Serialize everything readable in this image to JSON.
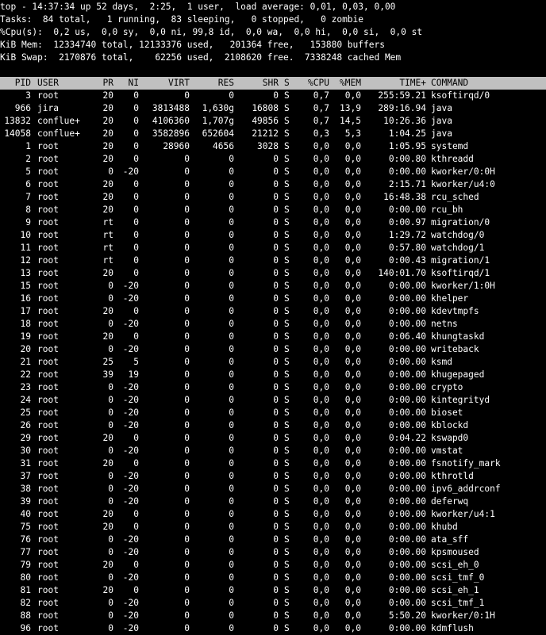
{
  "summary": {
    "line1": "top - 14:37:34 up 52 days,  2:25,  1 user,  load average: 0,01, 0,03, 0,00",
    "line2": "Tasks:  84 total,   1 running,  83 sleeping,   0 stopped,   0 zombie",
    "line3": "%Cpu(s):  0,2 us,  0,0 sy,  0,0 ni, 99,8 id,  0,0 wa,  0,0 hi,  0,0 si,  0,0 st",
    "line4": "KiB Mem:  12334740 total, 12133376 used,   201364 free,   153880 buffers",
    "line5": "KiB Swap:  2170876 total,    62256 used,  2108620 free.  7338248 cached Mem"
  },
  "columns": {
    "pid": "PID",
    "user": "USER",
    "pr": "PR",
    "ni": "NI",
    "virt": "VIRT",
    "res": "RES",
    "shr": "SHR",
    "s": "S",
    "cpu": "%CPU",
    "mem": "%MEM",
    "time": "TIME+",
    "command": "COMMAND"
  },
  "processes": [
    {
      "pid": "3",
      "user": "root",
      "pr": "20",
      "ni": "0",
      "virt": "0",
      "res": "0",
      "shr": "0",
      "s": "S",
      "cpu": "0,7",
      "mem": "0,0",
      "time": "255:59.21",
      "command": "ksoftirqd/0"
    },
    {
      "pid": "966",
      "user": "jira",
      "pr": "20",
      "ni": "0",
      "virt": "3813488",
      "res": "1,630g",
      "shr": "16808",
      "s": "S",
      "cpu": "0,7",
      "mem": "13,9",
      "time": "289:16.94",
      "command": "java"
    },
    {
      "pid": "13832",
      "user": "conflue+",
      "pr": "20",
      "ni": "0",
      "virt": "4106360",
      "res": "1,707g",
      "shr": "49856",
      "s": "S",
      "cpu": "0,7",
      "mem": "14,5",
      "time": "10:26.36",
      "command": "java"
    },
    {
      "pid": "14058",
      "user": "conflue+",
      "pr": "20",
      "ni": "0",
      "virt": "3582896",
      "res": "652604",
      "shr": "21212",
      "s": "S",
      "cpu": "0,3",
      "mem": "5,3",
      "time": "1:04.25",
      "command": "java"
    },
    {
      "pid": "1",
      "user": "root",
      "pr": "20",
      "ni": "0",
      "virt": "28960",
      "res": "4656",
      "shr": "3028",
      "s": "S",
      "cpu": "0,0",
      "mem": "0,0",
      "time": "1:05.95",
      "command": "systemd"
    },
    {
      "pid": "2",
      "user": "root",
      "pr": "20",
      "ni": "0",
      "virt": "0",
      "res": "0",
      "shr": "0",
      "s": "S",
      "cpu": "0,0",
      "mem": "0,0",
      "time": "0:00.80",
      "command": "kthreadd"
    },
    {
      "pid": "5",
      "user": "root",
      "pr": "0",
      "ni": "-20",
      "virt": "0",
      "res": "0",
      "shr": "0",
      "s": "S",
      "cpu": "0,0",
      "mem": "0,0",
      "time": "0:00.00",
      "command": "kworker/0:0H"
    },
    {
      "pid": "6",
      "user": "root",
      "pr": "20",
      "ni": "0",
      "virt": "0",
      "res": "0",
      "shr": "0",
      "s": "S",
      "cpu": "0,0",
      "mem": "0,0",
      "time": "2:15.71",
      "command": "kworker/u4:0"
    },
    {
      "pid": "7",
      "user": "root",
      "pr": "20",
      "ni": "0",
      "virt": "0",
      "res": "0",
      "shr": "0",
      "s": "S",
      "cpu": "0,0",
      "mem": "0,0",
      "time": "16:48.38",
      "command": "rcu_sched"
    },
    {
      "pid": "8",
      "user": "root",
      "pr": "20",
      "ni": "0",
      "virt": "0",
      "res": "0",
      "shr": "0",
      "s": "S",
      "cpu": "0,0",
      "mem": "0,0",
      "time": "0:00.00",
      "command": "rcu_bh"
    },
    {
      "pid": "9",
      "user": "root",
      "pr": "rt",
      "ni": "0",
      "virt": "0",
      "res": "0",
      "shr": "0",
      "s": "S",
      "cpu": "0,0",
      "mem": "0,0",
      "time": "0:00.97",
      "command": "migration/0"
    },
    {
      "pid": "10",
      "user": "root",
      "pr": "rt",
      "ni": "0",
      "virt": "0",
      "res": "0",
      "shr": "0",
      "s": "S",
      "cpu": "0,0",
      "mem": "0,0",
      "time": "1:29.72",
      "command": "watchdog/0"
    },
    {
      "pid": "11",
      "user": "root",
      "pr": "rt",
      "ni": "0",
      "virt": "0",
      "res": "0",
      "shr": "0",
      "s": "S",
      "cpu": "0,0",
      "mem": "0,0",
      "time": "0:57.80",
      "command": "watchdog/1"
    },
    {
      "pid": "12",
      "user": "root",
      "pr": "rt",
      "ni": "0",
      "virt": "0",
      "res": "0",
      "shr": "0",
      "s": "S",
      "cpu": "0,0",
      "mem": "0,0",
      "time": "0:00.43",
      "command": "migration/1"
    },
    {
      "pid": "13",
      "user": "root",
      "pr": "20",
      "ni": "0",
      "virt": "0",
      "res": "0",
      "shr": "0",
      "s": "S",
      "cpu": "0,0",
      "mem": "0,0",
      "time": "140:01.70",
      "command": "ksoftirqd/1"
    },
    {
      "pid": "15",
      "user": "root",
      "pr": "0",
      "ni": "-20",
      "virt": "0",
      "res": "0",
      "shr": "0",
      "s": "S",
      "cpu": "0,0",
      "mem": "0,0",
      "time": "0:00.00",
      "command": "kworker/1:0H"
    },
    {
      "pid": "16",
      "user": "root",
      "pr": "0",
      "ni": "-20",
      "virt": "0",
      "res": "0",
      "shr": "0",
      "s": "S",
      "cpu": "0,0",
      "mem": "0,0",
      "time": "0:00.00",
      "command": "khelper"
    },
    {
      "pid": "17",
      "user": "root",
      "pr": "20",
      "ni": "0",
      "virt": "0",
      "res": "0",
      "shr": "0",
      "s": "S",
      "cpu": "0,0",
      "mem": "0,0",
      "time": "0:00.00",
      "command": "kdevtmpfs"
    },
    {
      "pid": "18",
      "user": "root",
      "pr": "0",
      "ni": "-20",
      "virt": "0",
      "res": "0",
      "shr": "0",
      "s": "S",
      "cpu": "0,0",
      "mem": "0,0",
      "time": "0:00.00",
      "command": "netns"
    },
    {
      "pid": "19",
      "user": "root",
      "pr": "20",
      "ni": "0",
      "virt": "0",
      "res": "0",
      "shr": "0",
      "s": "S",
      "cpu": "0,0",
      "mem": "0,0",
      "time": "0:06.40",
      "command": "khungtaskd"
    },
    {
      "pid": "20",
      "user": "root",
      "pr": "0",
      "ni": "-20",
      "virt": "0",
      "res": "0",
      "shr": "0",
      "s": "S",
      "cpu": "0,0",
      "mem": "0,0",
      "time": "0:00.00",
      "command": "writeback"
    },
    {
      "pid": "21",
      "user": "root",
      "pr": "25",
      "ni": "5",
      "virt": "0",
      "res": "0",
      "shr": "0",
      "s": "S",
      "cpu": "0,0",
      "mem": "0,0",
      "time": "0:00.00",
      "command": "ksmd"
    },
    {
      "pid": "22",
      "user": "root",
      "pr": "39",
      "ni": "19",
      "virt": "0",
      "res": "0",
      "shr": "0",
      "s": "S",
      "cpu": "0,0",
      "mem": "0,0",
      "time": "0:00.00",
      "command": "khugepaged"
    },
    {
      "pid": "23",
      "user": "root",
      "pr": "0",
      "ni": "-20",
      "virt": "0",
      "res": "0",
      "shr": "0",
      "s": "S",
      "cpu": "0,0",
      "mem": "0,0",
      "time": "0:00.00",
      "command": "crypto"
    },
    {
      "pid": "24",
      "user": "root",
      "pr": "0",
      "ni": "-20",
      "virt": "0",
      "res": "0",
      "shr": "0",
      "s": "S",
      "cpu": "0,0",
      "mem": "0,0",
      "time": "0:00.00",
      "command": "kintegrityd"
    },
    {
      "pid": "25",
      "user": "root",
      "pr": "0",
      "ni": "-20",
      "virt": "0",
      "res": "0",
      "shr": "0",
      "s": "S",
      "cpu": "0,0",
      "mem": "0,0",
      "time": "0:00.00",
      "command": "bioset"
    },
    {
      "pid": "26",
      "user": "root",
      "pr": "0",
      "ni": "-20",
      "virt": "0",
      "res": "0",
      "shr": "0",
      "s": "S",
      "cpu": "0,0",
      "mem": "0,0",
      "time": "0:00.00",
      "command": "kblockd"
    },
    {
      "pid": "29",
      "user": "root",
      "pr": "20",
      "ni": "0",
      "virt": "0",
      "res": "0",
      "shr": "0",
      "s": "S",
      "cpu": "0,0",
      "mem": "0,0",
      "time": "0:04.22",
      "command": "kswapd0"
    },
    {
      "pid": "30",
      "user": "root",
      "pr": "0",
      "ni": "-20",
      "virt": "0",
      "res": "0",
      "shr": "0",
      "s": "S",
      "cpu": "0,0",
      "mem": "0,0",
      "time": "0:00.00",
      "command": "vmstat"
    },
    {
      "pid": "31",
      "user": "root",
      "pr": "20",
      "ni": "0",
      "virt": "0",
      "res": "0",
      "shr": "0",
      "s": "S",
      "cpu": "0,0",
      "mem": "0,0",
      "time": "0:00.00",
      "command": "fsnotify_mark"
    },
    {
      "pid": "37",
      "user": "root",
      "pr": "0",
      "ni": "-20",
      "virt": "0",
      "res": "0",
      "shr": "0",
      "s": "S",
      "cpu": "0,0",
      "mem": "0,0",
      "time": "0:00.00",
      "command": "kthrotld"
    },
    {
      "pid": "38",
      "user": "root",
      "pr": "0",
      "ni": "-20",
      "virt": "0",
      "res": "0",
      "shr": "0",
      "s": "S",
      "cpu": "0,0",
      "mem": "0,0",
      "time": "0:00.00",
      "command": "ipv6_addrconf"
    },
    {
      "pid": "39",
      "user": "root",
      "pr": "0",
      "ni": "-20",
      "virt": "0",
      "res": "0",
      "shr": "0",
      "s": "S",
      "cpu": "0,0",
      "mem": "0,0",
      "time": "0:00.00",
      "command": "deferwq"
    },
    {
      "pid": "40",
      "user": "root",
      "pr": "20",
      "ni": "0",
      "virt": "0",
      "res": "0",
      "shr": "0",
      "s": "S",
      "cpu": "0,0",
      "mem": "0,0",
      "time": "0:00.00",
      "command": "kworker/u4:1"
    },
    {
      "pid": "75",
      "user": "root",
      "pr": "20",
      "ni": "0",
      "virt": "0",
      "res": "0",
      "shr": "0",
      "s": "S",
      "cpu": "0,0",
      "mem": "0,0",
      "time": "0:00.00",
      "command": "khubd"
    },
    {
      "pid": "76",
      "user": "root",
      "pr": "0",
      "ni": "-20",
      "virt": "0",
      "res": "0",
      "shr": "0",
      "s": "S",
      "cpu": "0,0",
      "mem": "0,0",
      "time": "0:00.00",
      "command": "ata_sff"
    },
    {
      "pid": "77",
      "user": "root",
      "pr": "0",
      "ni": "-20",
      "virt": "0",
      "res": "0",
      "shr": "0",
      "s": "S",
      "cpu": "0,0",
      "mem": "0,0",
      "time": "0:00.00",
      "command": "kpsmoused"
    },
    {
      "pid": "79",
      "user": "root",
      "pr": "20",
      "ni": "0",
      "virt": "0",
      "res": "0",
      "shr": "0",
      "s": "S",
      "cpu": "0,0",
      "mem": "0,0",
      "time": "0:00.00",
      "command": "scsi_eh_0"
    },
    {
      "pid": "80",
      "user": "root",
      "pr": "0",
      "ni": "-20",
      "virt": "0",
      "res": "0",
      "shr": "0",
      "s": "S",
      "cpu": "0,0",
      "mem": "0,0",
      "time": "0:00.00",
      "command": "scsi_tmf_0"
    },
    {
      "pid": "81",
      "user": "root",
      "pr": "20",
      "ni": "0",
      "virt": "0",
      "res": "0",
      "shr": "0",
      "s": "S",
      "cpu": "0,0",
      "mem": "0,0",
      "time": "0:00.00",
      "command": "scsi_eh_1"
    },
    {
      "pid": "82",
      "user": "root",
      "pr": "0",
      "ni": "-20",
      "virt": "0",
      "res": "0",
      "shr": "0",
      "s": "S",
      "cpu": "0,0",
      "mem": "0,0",
      "time": "0:00.00",
      "command": "scsi_tmf_1"
    },
    {
      "pid": "88",
      "user": "root",
      "pr": "0",
      "ni": "-20",
      "virt": "0",
      "res": "0",
      "shr": "0",
      "s": "S",
      "cpu": "0,0",
      "mem": "0,0",
      "time": "5:50.20",
      "command": "kworker/0:1H"
    },
    {
      "pid": "96",
      "user": "root",
      "pr": "0",
      "ni": "-20",
      "virt": "0",
      "res": "0",
      "shr": "0",
      "s": "S",
      "cpu": "0,0",
      "mem": "0,0",
      "time": "0:00.00",
      "command": "kdmflush"
    }
  ]
}
